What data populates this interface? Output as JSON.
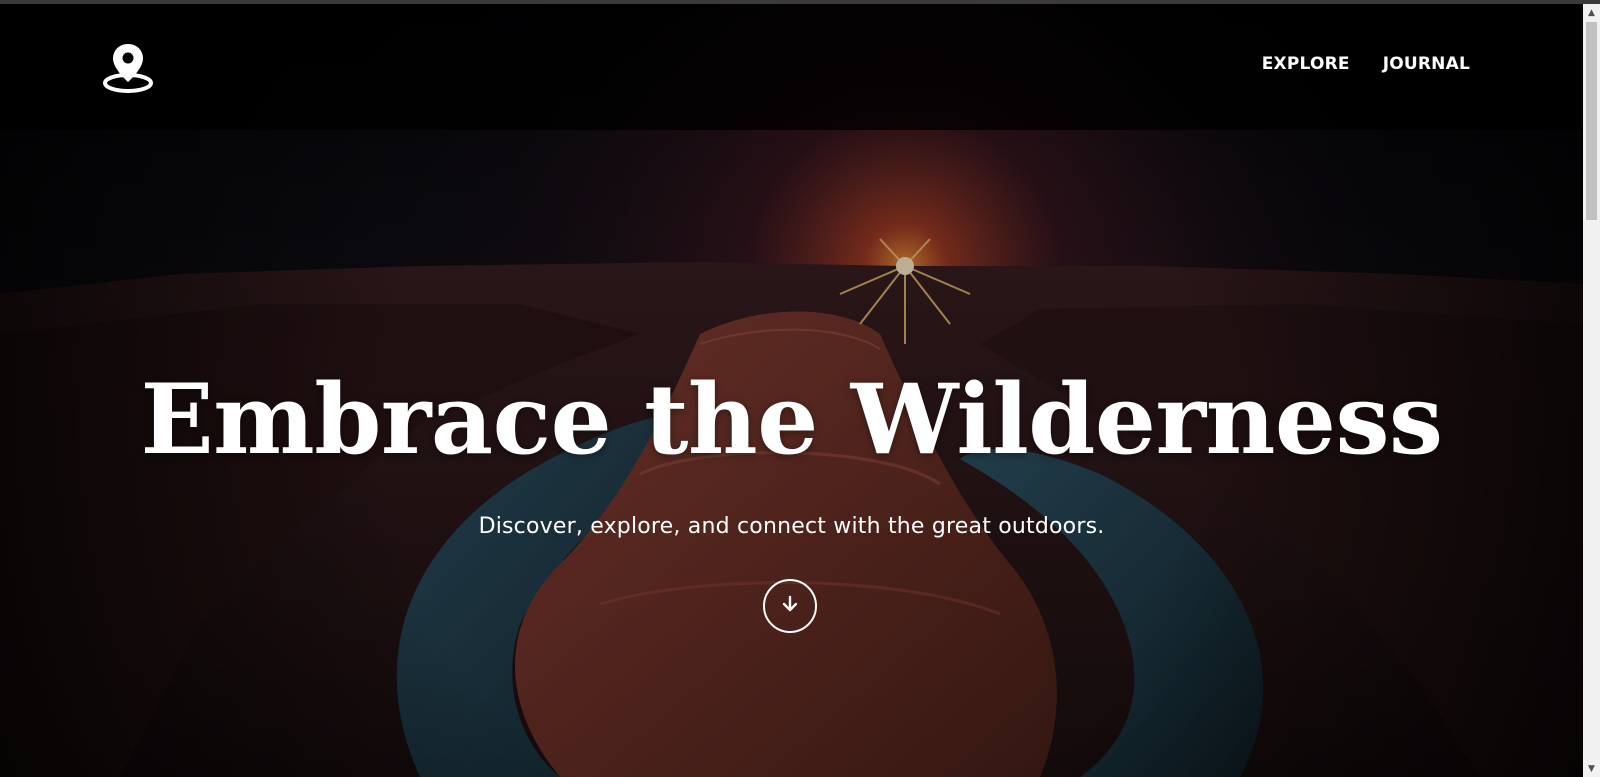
{
  "nav": {
    "logo_icon": "map-pin-icon",
    "links": [
      {
        "label": "EXPLORE"
      },
      {
        "label": "JOURNAL"
      }
    ]
  },
  "hero": {
    "title": "Embrace the Wilderness",
    "subtitle": "Discover, explore, and connect with the great outdoors.",
    "scroll_icon": "arrow-down-icon"
  },
  "scrollbar": {
    "up_icon": "scroll-up-arrow-icon",
    "down_icon": "scroll-down-arrow-icon"
  },
  "colors": {
    "text": "#ffffff",
    "nav_bg": "#000000",
    "rock": "#7a3a30",
    "river": "#1e3a4a",
    "sunset": "#e8622a"
  }
}
